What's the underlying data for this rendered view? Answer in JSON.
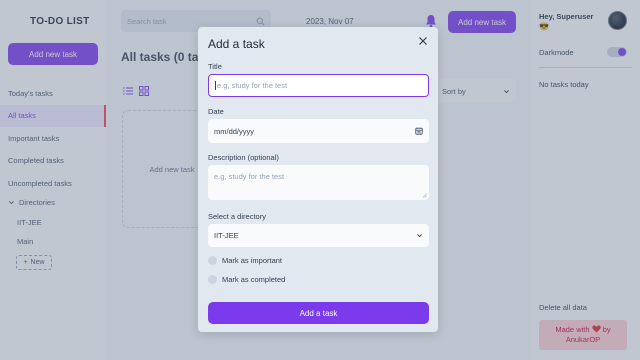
{
  "app": {
    "title": "TO-DO LIST"
  },
  "sidebar": {
    "add_button": "Add new task",
    "items": [
      {
        "label": "Today's tasks",
        "active": false
      },
      {
        "label": "All tasks",
        "active": true
      },
      {
        "label": "Important tasks",
        "active": false
      },
      {
        "label": "Completed tasks",
        "active": false
      },
      {
        "label": "Uncompleted tasks",
        "active": false
      }
    ],
    "directories_label": "Directories",
    "directories": [
      "IIT-JEE",
      "Main"
    ],
    "new_button": "New"
  },
  "header": {
    "search_placeholder": "Search task",
    "date": "2023, Nov 07",
    "add_button": "Add new task"
  },
  "main": {
    "heading": "All tasks (0 tasks)",
    "sort_label": "Sort by",
    "placeholder_card": "Add new task"
  },
  "right": {
    "greeting": "Hey, Superuser",
    "emoji": "😎",
    "darkmode_label": "Darkmode",
    "no_tasks": "No tasks today",
    "delete_all": "Delete all data",
    "made_with": "Made with",
    "by": "by",
    "author": "AnukarOP"
  },
  "modal": {
    "title": "Add a task",
    "title_label": "Title",
    "title_placeholder": "e.g, study for the test",
    "date_label": "Date",
    "date_placeholder": "mm/dd/yyyy",
    "description_label": "Description (optional)",
    "description_placeholder": "e.g, study for the test",
    "directory_label": "Select a directory",
    "directory_value": "IIT-JEE",
    "important_label": "Mark as important",
    "completed_label": "Mark as completed",
    "submit": "Add a task"
  },
  "colors": {
    "accent": "#7c3aed",
    "danger": "#f43f5e"
  }
}
